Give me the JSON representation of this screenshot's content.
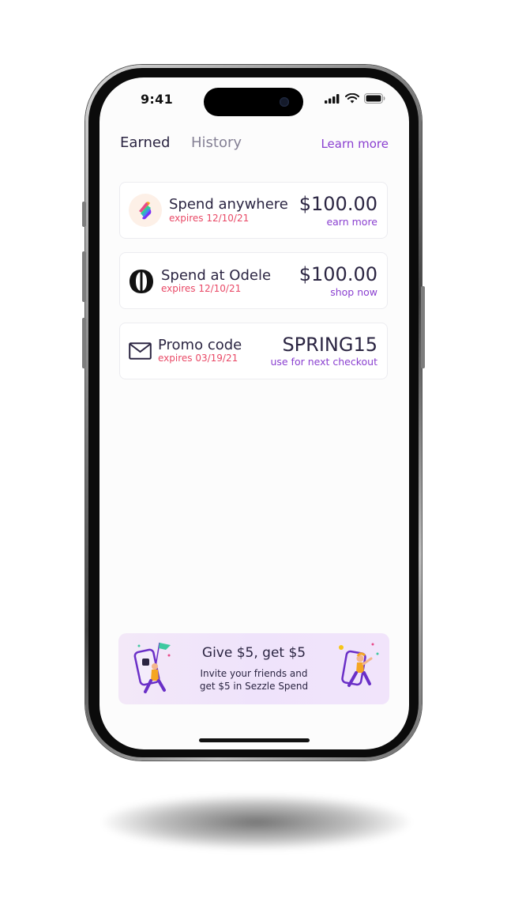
{
  "status_bar": {
    "time": "9:41"
  },
  "tabs": {
    "earned": "Earned",
    "history": "History",
    "learn_more": "Learn more"
  },
  "rewards": [
    {
      "title": "Spend anywhere",
      "expires": "expires 12/10/21",
      "value": "$100.00",
      "action": "earn more",
      "icon": "sezzle-logo-icon"
    },
    {
      "title": "Spend at Odele",
      "expires": "expires 12/10/21",
      "value": "$100.00",
      "action": "shop now",
      "icon": "odele-logo-icon"
    },
    {
      "title": "Promo code",
      "expires": "expires 03/19/21",
      "value": "SPRING15",
      "action": "use for next checkout",
      "icon": "envelope-icon"
    }
  ],
  "banner": {
    "title": "Give $5, get $5",
    "line1": "Invite your friends and",
    "line2": "get $5 in Sezzle Spend"
  },
  "colors": {
    "accent": "#8a3fd0",
    "expires": "#e94a67",
    "text": "#2b2542",
    "banner_bg": "#f1e6fa"
  }
}
